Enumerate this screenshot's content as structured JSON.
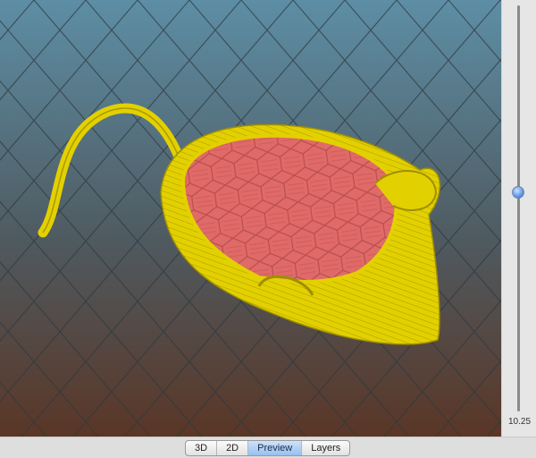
{
  "viewport": {
    "view": "Preview",
    "bg_top": "#5d8ea5",
    "bg_bottom": "#5a3626",
    "perimeter_color": "#e3d000",
    "infill_color": "#e06a68"
  },
  "layer_slider": {
    "value_label": "10.25",
    "position_fraction": 0.54
  },
  "view_tabs": [
    {
      "label": "3D",
      "active": false
    },
    {
      "label": "2D",
      "active": false
    },
    {
      "label": "Preview",
      "active": true
    },
    {
      "label": "Layers",
      "active": false
    }
  ]
}
